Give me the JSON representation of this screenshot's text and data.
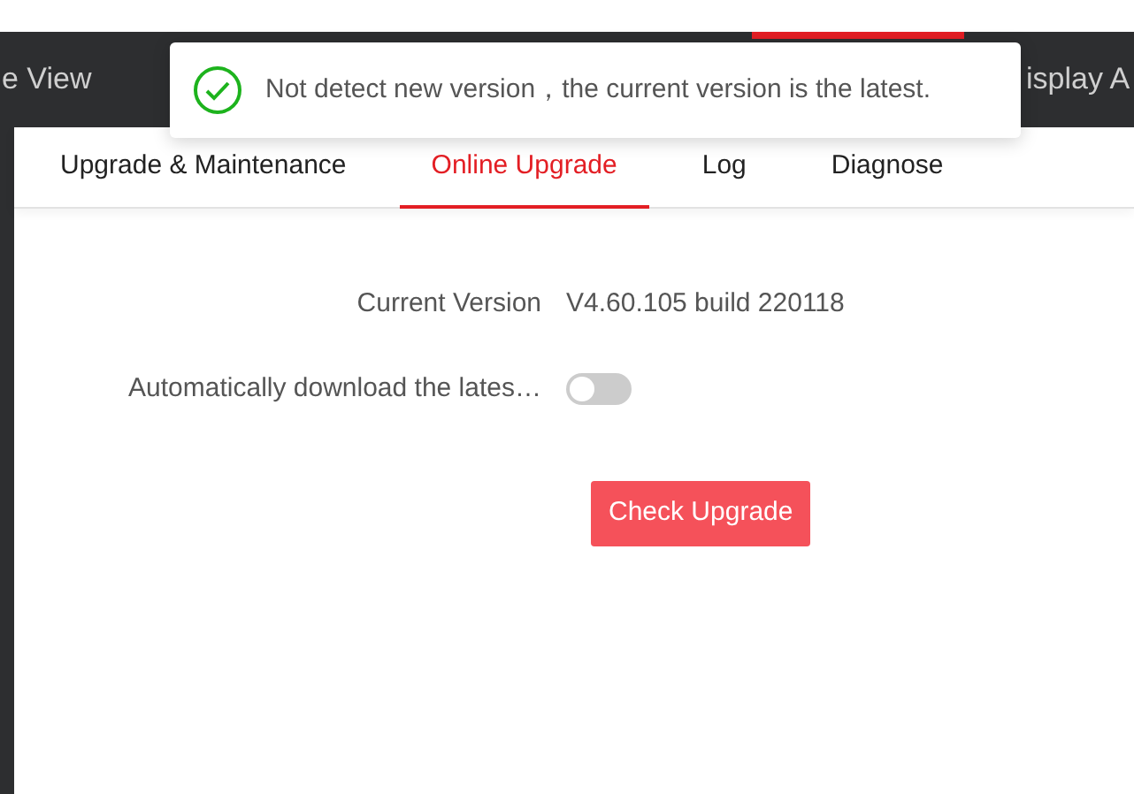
{
  "top_nav": {
    "items": [
      {
        "label": "e View",
        "selected": false
      },
      {
        "selected": true
      },
      {
        "label": "isplay A",
        "selected": false
      }
    ]
  },
  "toast": {
    "kind": "success",
    "message": "Not detect new version，the current version is the latest."
  },
  "tabs": [
    {
      "label": "Upgrade & Maintenance",
      "selected": false
    },
    {
      "label": "Online Upgrade",
      "selected": true
    },
    {
      "label": "Log",
      "selected": false
    },
    {
      "label": "Diagnose",
      "selected": false
    }
  ],
  "form": {
    "current_version": {
      "label": "Current Version",
      "value": "V4.60.105 build 220118"
    },
    "auto_download": {
      "label": "Automatically download the lates…",
      "on": false
    }
  },
  "buttons": [
    {
      "label": "Check Upgrade"
    }
  ]
}
